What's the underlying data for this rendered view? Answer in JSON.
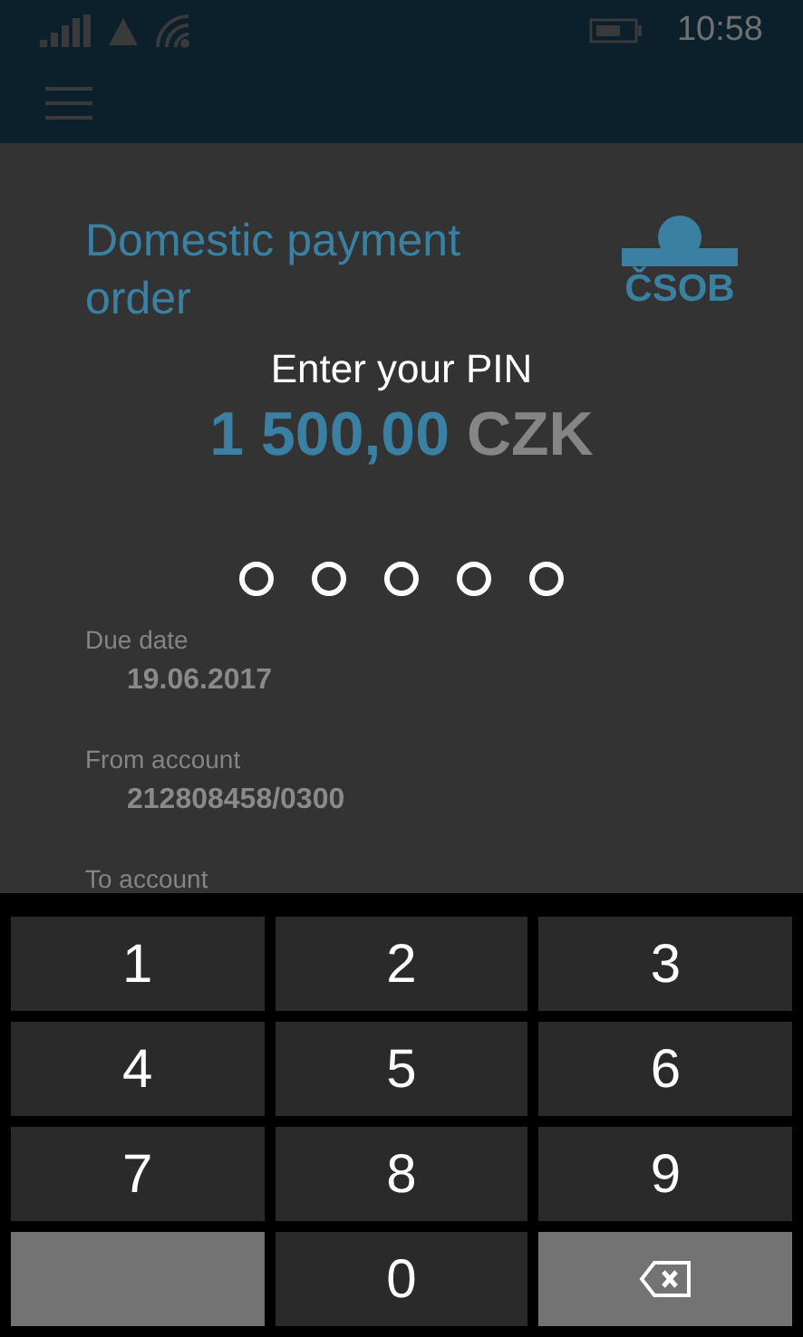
{
  "status_bar": {
    "time": "10:58"
  },
  "order": {
    "title": "Domestic payment order",
    "logo_text": "ČSOB",
    "amount": "1 500,00",
    "currency": "CZK",
    "fields": [
      {
        "label": "Due date",
        "value": "19.06.2017"
      },
      {
        "label": "From account",
        "value": "212808458/0300"
      },
      {
        "label": "To account"
      }
    ]
  },
  "pin_prompt": {
    "title": "Enter your PIN",
    "dots": [
      {
        "filled": false
      },
      {
        "filled": false
      },
      {
        "filled": false
      },
      {
        "filled": false
      },
      {
        "filled": false
      }
    ]
  },
  "keypad": [
    {
      "kind": "digit",
      "label": "1"
    },
    {
      "kind": "digit",
      "label": "2"
    },
    {
      "kind": "digit",
      "label": "3"
    },
    {
      "kind": "digit",
      "label": "4"
    },
    {
      "kind": "digit",
      "label": "5"
    },
    {
      "kind": "digit",
      "label": "6"
    },
    {
      "kind": "digit",
      "label": "7"
    },
    {
      "kind": "digit",
      "label": "8"
    },
    {
      "kind": "digit",
      "label": "9"
    },
    {
      "kind": "blank"
    },
    {
      "kind": "digit",
      "label": "0"
    },
    {
      "kind": "backspace"
    }
  ]
}
